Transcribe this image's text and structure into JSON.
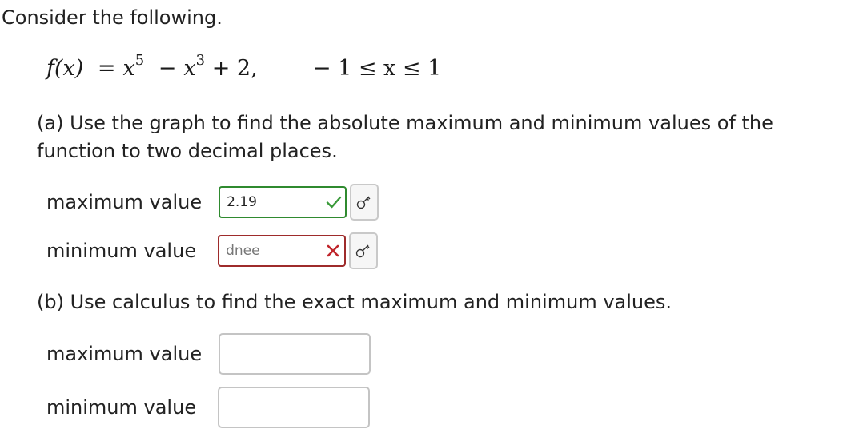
{
  "question": {
    "intro": "Consider the following.",
    "formula": {
      "lhs": "f(x)",
      "equals": "=",
      "term1_base": "x",
      "term1_exp": "5",
      "minus": "−",
      "term2_base": "x",
      "term2_exp": "3",
      "plus_const": "+ 2,",
      "domain": "− 1 ≤ x ≤ 1"
    }
  },
  "part_a": {
    "prompt": "(a) Use the graph to find the absolute maximum and minimum values of the function to two decimal places.",
    "max_label": "maximum value",
    "max_value": "2.19",
    "max_status": "correct",
    "min_label": "minimum value",
    "min_value": "dnee",
    "min_status": "incorrect"
  },
  "part_b": {
    "prompt": "(b) Use calculus to find the exact maximum and minimum values.",
    "max_label": "maximum value",
    "max_value": "",
    "min_label": "minimum value",
    "min_value": ""
  },
  "icons": {
    "correct": "check-icon",
    "incorrect": "x-mark-icon",
    "key": "key-icon"
  },
  "colors": {
    "correct": "#2f8a2f",
    "incorrect": "#9e2b2b",
    "check": "#3a9a3a",
    "cross": "#c0262c"
  }
}
